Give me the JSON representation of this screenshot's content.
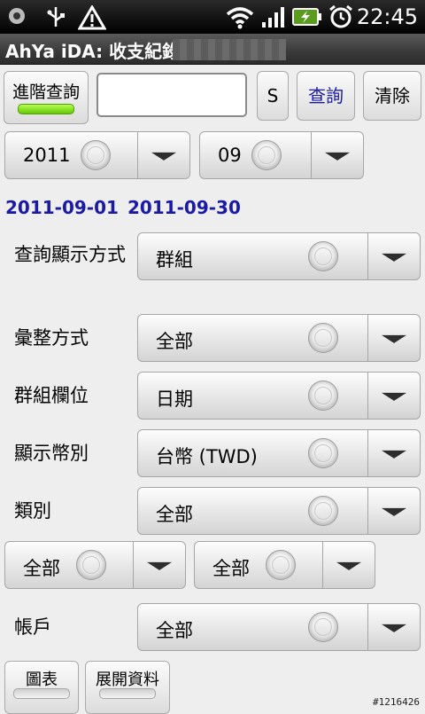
{
  "status_bar": {
    "time": "22:45",
    "icons": [
      "notification-circle-icon",
      "usb-icon",
      "warning-icon",
      "wifi-icon",
      "signal-icon",
      "battery-charging-icon",
      "alarm-clock-icon"
    ]
  },
  "title": "AhYa iDA: 收支紀錄",
  "toolbar": {
    "advanced_query": "進階查詢",
    "search_placeholder": "",
    "s_button": "S",
    "query_button": "查詢",
    "clear_button": "清除"
  },
  "year_spinner": "2011",
  "month_spinner": "09",
  "date_range": {
    "start": "2011-09-01",
    "end": "2011-09-30"
  },
  "form": {
    "display_mode": {
      "label": "查詢顯示方式",
      "value": "群組"
    },
    "aggregate_mode": {
      "label": "彙整方式",
      "value": "全部"
    },
    "group_field": {
      "label": "群組欄位",
      "value": "日期"
    },
    "currency": {
      "label": "顯示幣別",
      "value": "台幣 (TWD)"
    },
    "category": {
      "label": "類別",
      "value": "全部"
    },
    "sub_left": "全部",
    "sub_right": "全部",
    "account": {
      "label": "帳戶",
      "value": "全部"
    }
  },
  "bottom": {
    "chart_button": "圖表",
    "expand_button": "展開資料"
  },
  "watermark": "#1216426",
  "colors": {
    "date_range": "#1a1aa6",
    "query_text": "#1a1aa6",
    "toggle_on": "#7ed321"
  }
}
